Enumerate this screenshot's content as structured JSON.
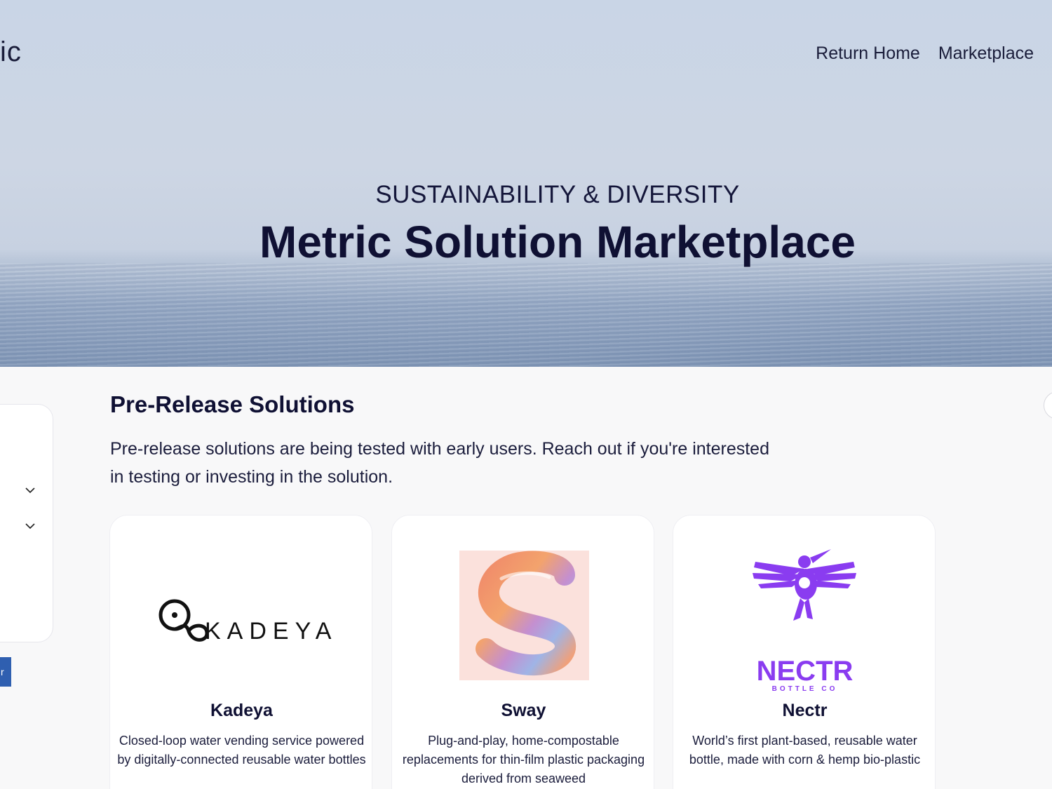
{
  "header": {
    "logo_fragment": "ic",
    "nav": [
      "Return Home",
      "Marketplace"
    ]
  },
  "hero": {
    "eyebrow": "SUSTAINABILITY & DIVERSITY",
    "title": "Metric Solution Marketplace"
  },
  "sidebar": {
    "tab_label": "r"
  },
  "section": {
    "title": "Pre-Release Solutions",
    "description_line1": "Pre-release solutions are being tested with early users. Reach out if you're interested",
    "description_line2": "in testing or investing in the solution."
  },
  "cards": [
    {
      "name": "Kadeya",
      "logo_text": "KADEYA",
      "description": "Closed-loop water vending service powered by digitally-connected reusable water bottles"
    },
    {
      "name": "Sway",
      "description": "Plug-and-play, home-compostable replacements for thin-film plastic packaging derived from seaweed"
    },
    {
      "name": "Nectr",
      "logo_text": "NECTR",
      "logo_subtext": "BOTTLE CO",
      "description": "World’s first plant-based, reusable water bottle, made with corn & hemp bio-plastic"
    }
  ],
  "colors": {
    "brand_navy": "#0f1033",
    "nectr_purple": "#8a3cf0",
    "tab_blue": "#2f5fb0"
  }
}
